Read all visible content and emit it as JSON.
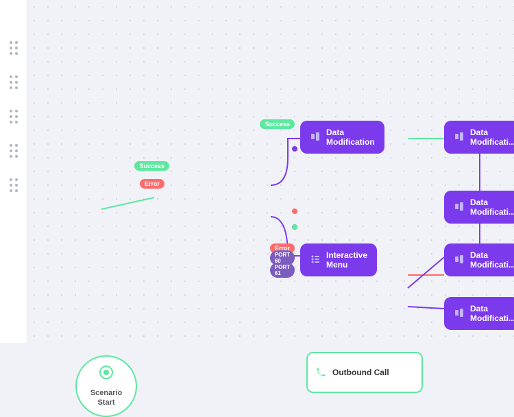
{
  "sidebar": {
    "items": [
      {
        "label": "dots-1"
      },
      {
        "label": "dots-2"
      },
      {
        "label": "dots-3"
      },
      {
        "label": "dots-4"
      },
      {
        "label": "dots-5"
      }
    ]
  },
  "nodes": {
    "scenario_start": {
      "label_line1": "Scenario",
      "label_line2": "Start",
      "icon": "⊙"
    },
    "outbound_call": {
      "label": "Outbound Call",
      "icon": "📞"
    },
    "data_mod_1": {
      "label": "Data Modification"
    },
    "data_mod_2": {
      "label": "Data Modificati..."
    },
    "data_mod_3": {
      "label": "Data Modificati..."
    },
    "data_mod_4": {
      "label": "Data Modificati..."
    },
    "data_mod_5": {
      "label": "Data Modificati..."
    },
    "interactive_menu": {
      "label": "Interactive Menu"
    }
  },
  "badges": {
    "error": "Error",
    "success": "Success",
    "port60": "PORT 60",
    "port61": "PORT 61"
  },
  "colors": {
    "green": "#5de8a0",
    "purple": "#7c3aed",
    "red": "#ff6b6b",
    "bg": "#f0f2f7"
  }
}
